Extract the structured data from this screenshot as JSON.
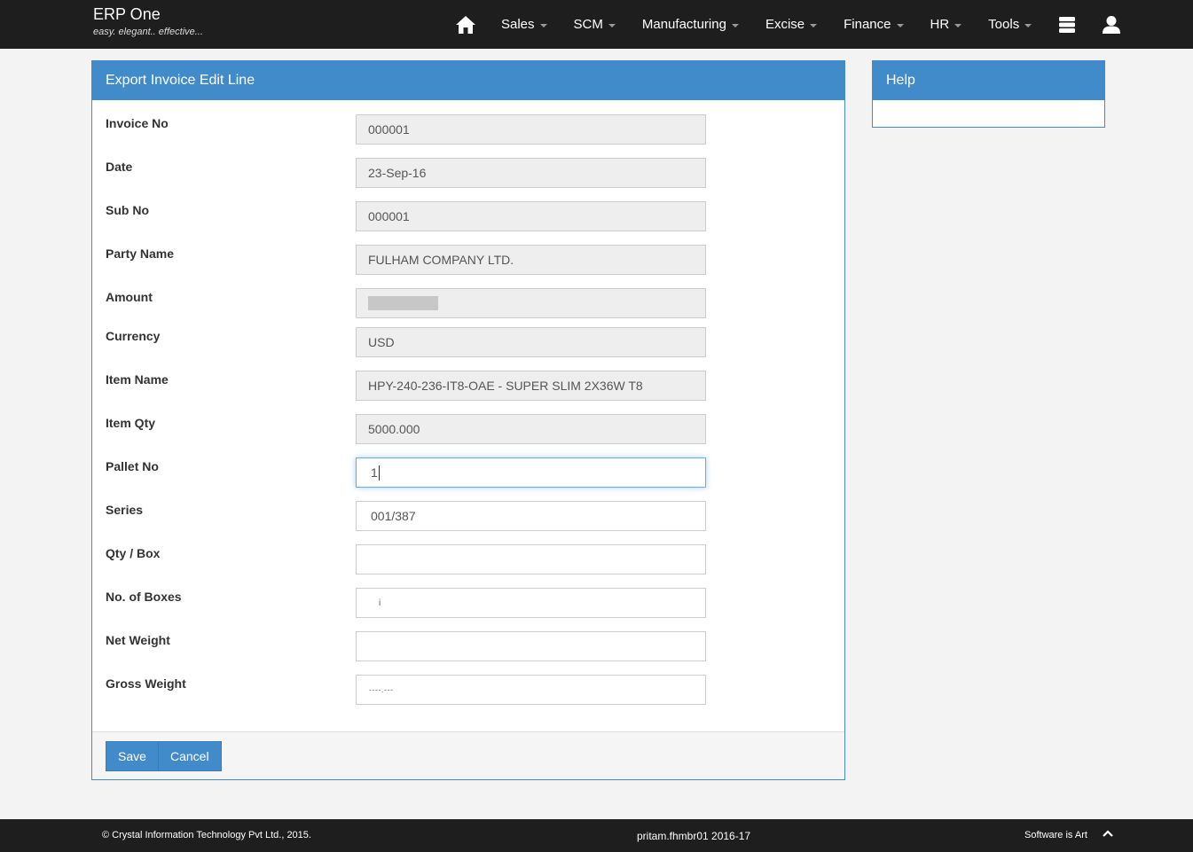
{
  "app": {
    "title": "ERP One",
    "tagline": "easy. elegant.. effective..."
  },
  "nav": {
    "home_icon": "home-icon",
    "items": [
      {
        "label": "Sales"
      },
      {
        "label": "SCM"
      },
      {
        "label": "Manufacturing"
      },
      {
        "label": "Excise"
      },
      {
        "label": "Finance"
      },
      {
        "label": "HR"
      },
      {
        "label": "Tools"
      }
    ],
    "right_icons": [
      "database-icon",
      "user-icon"
    ]
  },
  "panel": {
    "title": "Export Invoice Edit Line",
    "fields": [
      {
        "label": "Invoice No",
        "value": "000001",
        "readonly": true
      },
      {
        "label": "Date",
        "value": "23-Sep-16",
        "readonly": true
      },
      {
        "label": "Sub No",
        "value": "000001",
        "readonly": true
      },
      {
        "label": "Party Name",
        "value": "FULHAM COMPANY LTD.",
        "readonly": true
      },
      {
        "label": "Amount",
        "value": "",
        "readonly": true,
        "masked": true
      },
      {
        "label": "Currency",
        "value": "USD",
        "readonly": true
      },
      {
        "label": "Item Name",
        "value": "HPY-240-236-IT8-OAE - SUPER SLIM 2X36W T8",
        "readonly": true
      },
      {
        "label": "Item Qty",
        "value": "5000.000",
        "readonly": true
      },
      {
        "label": "Pallet No",
        "value": "1",
        "readonly": false,
        "focused": true
      },
      {
        "label": "Series",
        "value": "001/387",
        "readonly": false
      },
      {
        "label": "Qty / Box",
        "value": "",
        "readonly": false
      },
      {
        "label": "No. of Boxes",
        "value": "i",
        "readonly": false
      },
      {
        "label": "Net Weight",
        "value": "",
        "readonly": false
      },
      {
        "label": "Gross Weight",
        "value": "- - - - . - - -",
        "readonly": false
      }
    ],
    "save_label": "Save",
    "cancel_label": "Cancel"
  },
  "help": {
    "title": "Help"
  },
  "footer": {
    "copyright": "© Crystal Information Technology Pvt Ltd., 2015.",
    "session": "pritam.fhmbr01 2016-17",
    "slogan": "Software is Art"
  },
  "colors": {
    "primary": "#428bca",
    "navbar": "#1e1e1e"
  }
}
